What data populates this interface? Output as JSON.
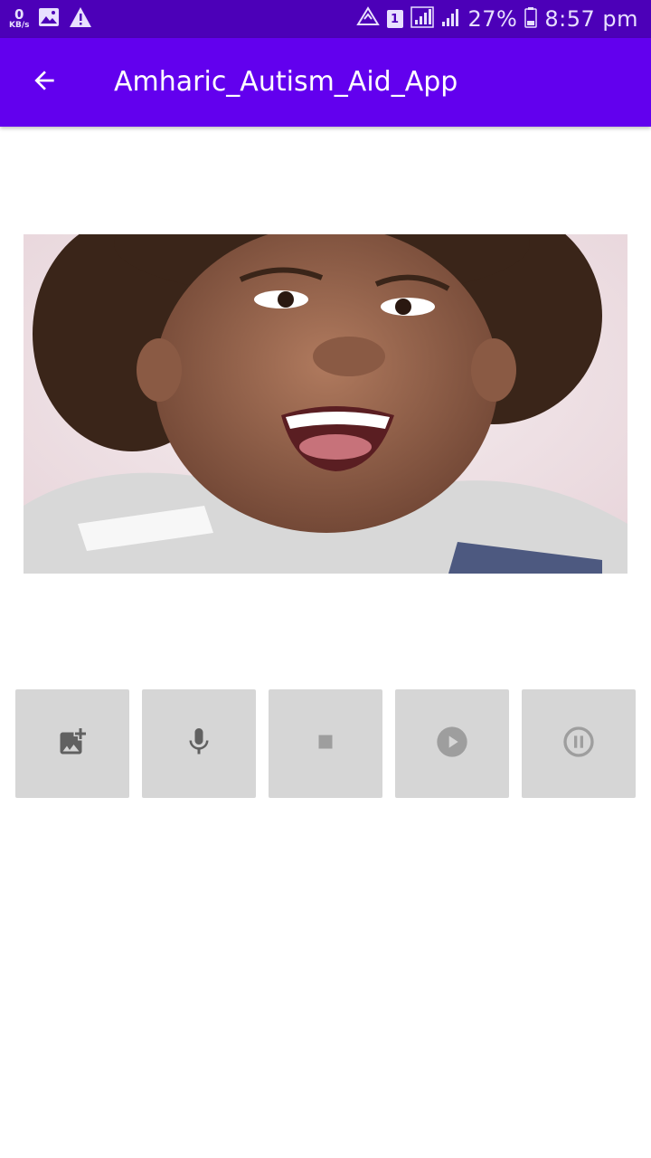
{
  "status_bar": {
    "net_speed_value": "0",
    "net_speed_unit": "KB/s",
    "sim_slot": "1",
    "battery": "27%",
    "time": "8:57 pm",
    "icons": [
      "image-icon",
      "warning-icon",
      "data-sync-icon",
      "sim-badge",
      "signal-icon",
      "signal-icon",
      "battery-icon"
    ]
  },
  "app_bar": {
    "title": "Amharic_Autism_Aid_App",
    "back_icon": "arrow-back-icon",
    "color": "#6200ee"
  },
  "main": {
    "image_alt": "photo of smiling child"
  },
  "controls": [
    {
      "name": "add-image-button",
      "icon": "add-photo-icon"
    },
    {
      "name": "record-button",
      "icon": "mic-icon"
    },
    {
      "name": "stop-button",
      "icon": "stop-icon"
    },
    {
      "name": "play-button",
      "icon": "play-circle-icon"
    },
    {
      "name": "pause-button",
      "icon": "pause-circle-icon"
    }
  ]
}
